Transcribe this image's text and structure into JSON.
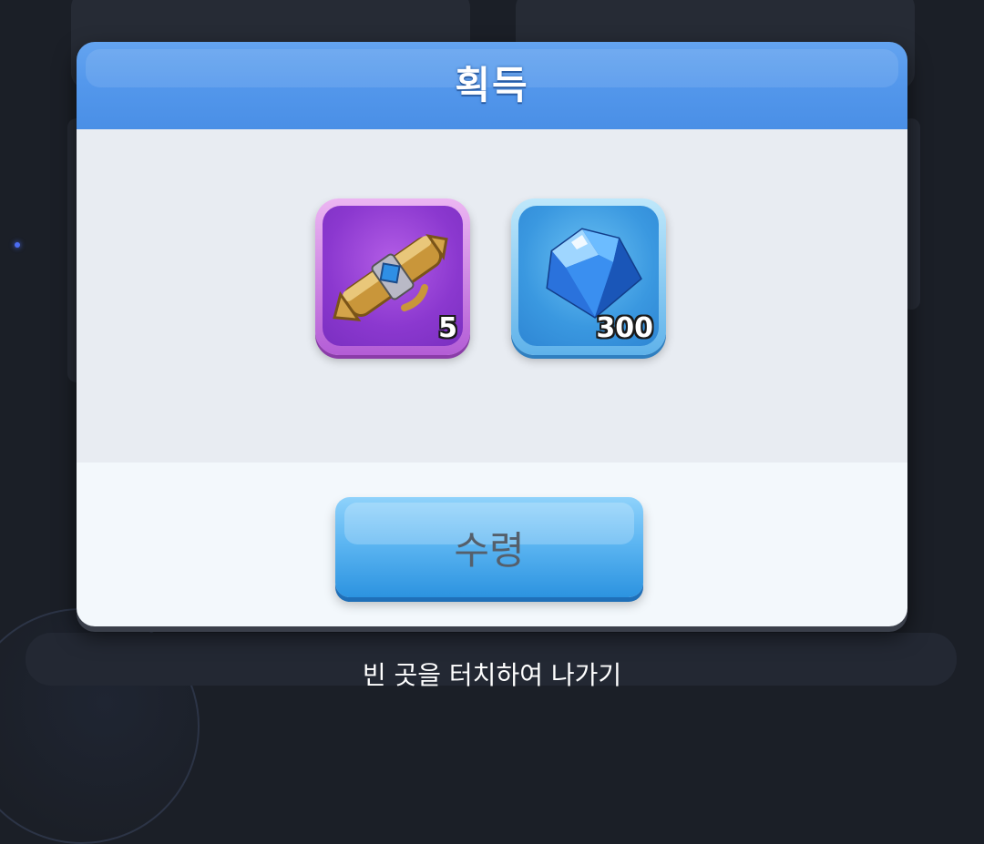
{
  "modal": {
    "title": "획득",
    "rewards": [
      {
        "name": "scroll",
        "icon": "scroll-icon",
        "quantity": "5"
      },
      {
        "name": "diamond",
        "icon": "diamond-icon",
        "quantity": "300"
      }
    ],
    "claim_label": "수령"
  },
  "exit_hint": "빈 곳을 터치하여 나가기",
  "colors": {
    "header_blue": "#4a8fe6",
    "scroll_purple": "#8b38cf",
    "gem_blue": "#3a98e0",
    "button_blue": "#5db6f2"
  }
}
